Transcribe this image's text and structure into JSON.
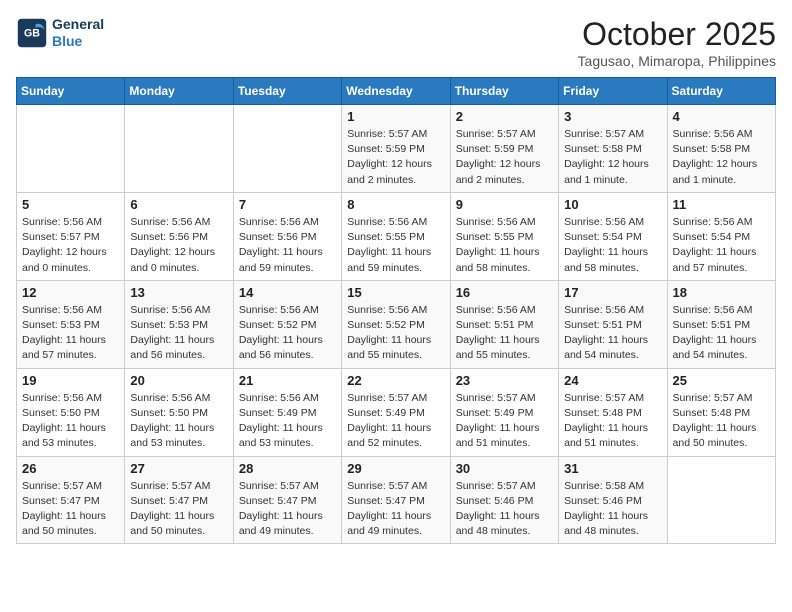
{
  "header": {
    "logo_line1": "General",
    "logo_line2": "Blue",
    "month": "October 2025",
    "location": "Tagusao, Mimaropa, Philippines"
  },
  "days_of_week": [
    "Sunday",
    "Monday",
    "Tuesday",
    "Wednesday",
    "Thursday",
    "Friday",
    "Saturday"
  ],
  "weeks": [
    [
      {
        "day": "",
        "info": ""
      },
      {
        "day": "",
        "info": ""
      },
      {
        "day": "",
        "info": ""
      },
      {
        "day": "1",
        "info": "Sunrise: 5:57 AM\nSunset: 5:59 PM\nDaylight: 12 hours\nand 2 minutes."
      },
      {
        "day": "2",
        "info": "Sunrise: 5:57 AM\nSunset: 5:59 PM\nDaylight: 12 hours\nand 2 minutes."
      },
      {
        "day": "3",
        "info": "Sunrise: 5:57 AM\nSunset: 5:58 PM\nDaylight: 12 hours\nand 1 minute."
      },
      {
        "day": "4",
        "info": "Sunrise: 5:56 AM\nSunset: 5:58 PM\nDaylight: 12 hours\nand 1 minute."
      }
    ],
    [
      {
        "day": "5",
        "info": "Sunrise: 5:56 AM\nSunset: 5:57 PM\nDaylight: 12 hours\nand 0 minutes."
      },
      {
        "day": "6",
        "info": "Sunrise: 5:56 AM\nSunset: 5:56 PM\nDaylight: 12 hours\nand 0 minutes."
      },
      {
        "day": "7",
        "info": "Sunrise: 5:56 AM\nSunset: 5:56 PM\nDaylight: 11 hours\nand 59 minutes."
      },
      {
        "day": "8",
        "info": "Sunrise: 5:56 AM\nSunset: 5:55 PM\nDaylight: 11 hours\nand 59 minutes."
      },
      {
        "day": "9",
        "info": "Sunrise: 5:56 AM\nSunset: 5:55 PM\nDaylight: 11 hours\nand 58 minutes."
      },
      {
        "day": "10",
        "info": "Sunrise: 5:56 AM\nSunset: 5:54 PM\nDaylight: 11 hours\nand 58 minutes."
      },
      {
        "day": "11",
        "info": "Sunrise: 5:56 AM\nSunset: 5:54 PM\nDaylight: 11 hours\nand 57 minutes."
      }
    ],
    [
      {
        "day": "12",
        "info": "Sunrise: 5:56 AM\nSunset: 5:53 PM\nDaylight: 11 hours\nand 57 minutes."
      },
      {
        "day": "13",
        "info": "Sunrise: 5:56 AM\nSunset: 5:53 PM\nDaylight: 11 hours\nand 56 minutes."
      },
      {
        "day": "14",
        "info": "Sunrise: 5:56 AM\nSunset: 5:52 PM\nDaylight: 11 hours\nand 56 minutes."
      },
      {
        "day": "15",
        "info": "Sunrise: 5:56 AM\nSunset: 5:52 PM\nDaylight: 11 hours\nand 55 minutes."
      },
      {
        "day": "16",
        "info": "Sunrise: 5:56 AM\nSunset: 5:51 PM\nDaylight: 11 hours\nand 55 minutes."
      },
      {
        "day": "17",
        "info": "Sunrise: 5:56 AM\nSunset: 5:51 PM\nDaylight: 11 hours\nand 54 minutes."
      },
      {
        "day": "18",
        "info": "Sunrise: 5:56 AM\nSunset: 5:51 PM\nDaylight: 11 hours\nand 54 minutes."
      }
    ],
    [
      {
        "day": "19",
        "info": "Sunrise: 5:56 AM\nSunset: 5:50 PM\nDaylight: 11 hours\nand 53 minutes."
      },
      {
        "day": "20",
        "info": "Sunrise: 5:56 AM\nSunset: 5:50 PM\nDaylight: 11 hours\nand 53 minutes."
      },
      {
        "day": "21",
        "info": "Sunrise: 5:56 AM\nSunset: 5:49 PM\nDaylight: 11 hours\nand 53 minutes."
      },
      {
        "day": "22",
        "info": "Sunrise: 5:57 AM\nSunset: 5:49 PM\nDaylight: 11 hours\nand 52 minutes."
      },
      {
        "day": "23",
        "info": "Sunrise: 5:57 AM\nSunset: 5:49 PM\nDaylight: 11 hours\nand 51 minutes."
      },
      {
        "day": "24",
        "info": "Sunrise: 5:57 AM\nSunset: 5:48 PM\nDaylight: 11 hours\nand 51 minutes."
      },
      {
        "day": "25",
        "info": "Sunrise: 5:57 AM\nSunset: 5:48 PM\nDaylight: 11 hours\nand 50 minutes."
      }
    ],
    [
      {
        "day": "26",
        "info": "Sunrise: 5:57 AM\nSunset: 5:47 PM\nDaylight: 11 hours\nand 50 minutes."
      },
      {
        "day": "27",
        "info": "Sunrise: 5:57 AM\nSunset: 5:47 PM\nDaylight: 11 hours\nand 50 minutes."
      },
      {
        "day": "28",
        "info": "Sunrise: 5:57 AM\nSunset: 5:47 PM\nDaylight: 11 hours\nand 49 minutes."
      },
      {
        "day": "29",
        "info": "Sunrise: 5:57 AM\nSunset: 5:47 PM\nDaylight: 11 hours\nand 49 minutes."
      },
      {
        "day": "30",
        "info": "Sunrise: 5:57 AM\nSunset: 5:46 PM\nDaylight: 11 hours\nand 48 minutes."
      },
      {
        "day": "31",
        "info": "Sunrise: 5:58 AM\nSunset: 5:46 PM\nDaylight: 11 hours\nand 48 minutes."
      },
      {
        "day": "",
        "info": ""
      }
    ]
  ]
}
